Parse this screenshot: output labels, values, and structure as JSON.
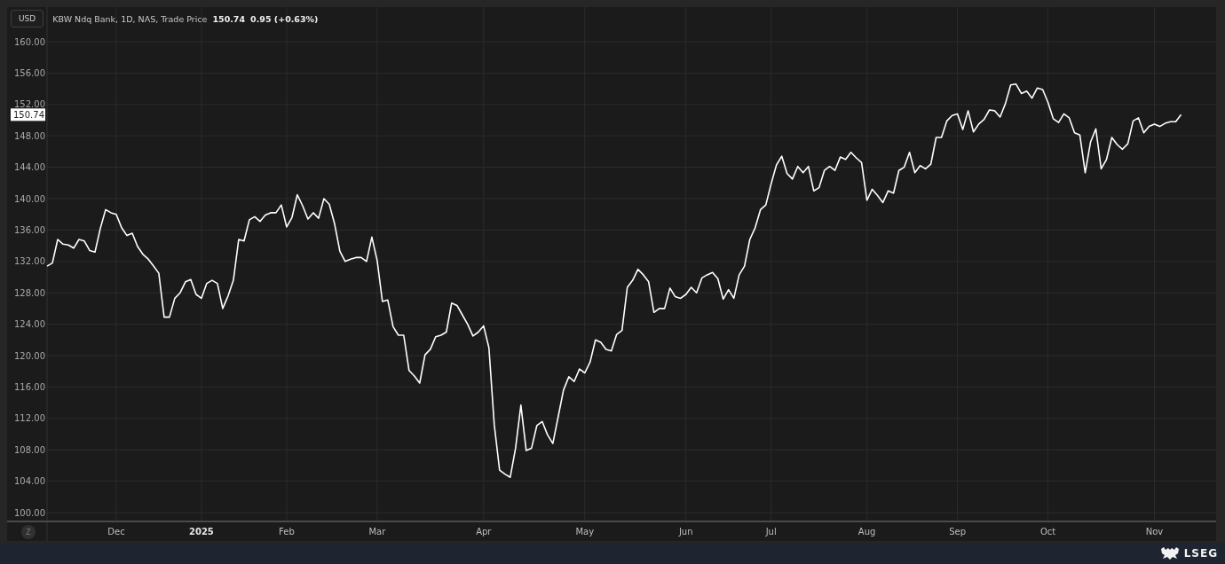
{
  "header": {
    "currency": "USD",
    "instrument": "KBW Ndq Bank, 1D, NAS, Trade Price",
    "last": "150.74",
    "change": "0.95 (+0.63%)"
  },
  "price_marker": "150.74",
  "zoom_button": "Z",
  "chart_data": {
    "type": "line",
    "ylim": [
      98.87,
      164.41
    ],
    "grid": true,
    "yticks": [
      {
        "value": 100,
        "label": "100.00"
      },
      {
        "value": 104,
        "label": "104.00"
      },
      {
        "value": 108,
        "label": "108.00"
      },
      {
        "value": 112,
        "label": "112.00"
      },
      {
        "value": 116,
        "label": "116.00"
      },
      {
        "value": 120,
        "label": "120.00"
      },
      {
        "value": 124,
        "label": "124.00"
      },
      {
        "value": 128,
        "label": "128.00"
      },
      {
        "value": 132,
        "label": "132.00"
      },
      {
        "value": 136,
        "label": "136.00"
      },
      {
        "value": 140,
        "label": "140.00"
      },
      {
        "value": 144,
        "label": "144.00"
      },
      {
        "value": 148,
        "label": "148.00"
      },
      {
        "value": 152,
        "label": "152.00"
      },
      {
        "value": 156,
        "label": "156.00"
      },
      {
        "value": 160,
        "label": "160.00"
      }
    ],
    "categories": [
      null,
      null,
      null,
      null,
      null,
      null,
      null,
      null,
      null,
      null,
      null,
      null,
      null,
      "Dec",
      null,
      null,
      null,
      null,
      null,
      null,
      null,
      null,
      null,
      null,
      null,
      null,
      null,
      null,
      null,
      "2025",
      null,
      null,
      null,
      null,
      null,
      null,
      null,
      null,
      null,
      null,
      null,
      null,
      null,
      null,
      null,
      "Feb",
      null,
      null,
      null,
      null,
      null,
      null,
      null,
      null,
      null,
      null,
      null,
      null,
      null,
      null,
      null,
      null,
      "Mar",
      null,
      null,
      null,
      null,
      null,
      null,
      null,
      null,
      null,
      null,
      null,
      null,
      null,
      null,
      null,
      null,
      null,
      null,
      null,
      "Apr",
      null,
      null,
      null,
      null,
      null,
      null,
      null,
      null,
      null,
      null,
      null,
      null,
      null,
      null,
      null,
      null,
      null,
      null,
      "May",
      null,
      null,
      null,
      null,
      null,
      null,
      null,
      null,
      null,
      null,
      null,
      null,
      null,
      null,
      null,
      null,
      null,
      null,
      "Jun",
      null,
      null,
      null,
      null,
      null,
      null,
      null,
      null,
      null,
      null,
      null,
      null,
      null,
      null,
      null,
      "Jul",
      null,
      null,
      null,
      null,
      null,
      null,
      null,
      null,
      null,
      null,
      null,
      null,
      null,
      null,
      null,
      null,
      null,
      "Aug",
      null,
      null,
      null,
      null,
      null,
      null,
      null,
      null,
      null,
      null,
      null,
      null,
      null,
      null,
      null,
      null,
      "Sep",
      null,
      null,
      null,
      null,
      null,
      null,
      null,
      null,
      null,
      null,
      null,
      null,
      null,
      null,
      null,
      null,
      "Oct",
      null,
      null,
      null,
      null,
      null,
      null,
      null,
      null,
      null,
      null,
      null,
      null,
      null,
      null,
      null,
      null,
      null,
      null,
      null,
      "Nov",
      null,
      null,
      null,
      null,
      null
    ],
    "series": [
      {
        "color": "#ffffff",
        "values": [
          131.4,
          131.8,
          134.8,
          134.2,
          134.1,
          133.7,
          134.8,
          134.6,
          133.4,
          133.2,
          136.2,
          138.6,
          138.2,
          138.0,
          136.3,
          135.3,
          135.6,
          133.9,
          132.9,
          132.3,
          131.4,
          130.5,
          124.9,
          124.9,
          127.3,
          128.0,
          129.4,
          129.7,
          127.8,
          127.3,
          129.2,
          129.6,
          129.2,
          126.0,
          127.6,
          129.6,
          134.8,
          134.6,
          137.3,
          137.7,
          137.1,
          137.9,
          138.2,
          138.2,
          139.2,
          136.4,
          137.6,
          140.5,
          139.1,
          137.4,
          138.2,
          137.5,
          140.0,
          139.3,
          136.8,
          133.3,
          132.0,
          132.3,
          132.5,
          132.5,
          132.0,
          135.1,
          132.1,
          126.9,
          127.1,
          123.7,
          122.6,
          122.6,
          118.1,
          117.4,
          116.5,
          120.1,
          120.8,
          122.4,
          122.6,
          123.0,
          126.7,
          126.4,
          125.2,
          124.0,
          122.5,
          123.0,
          123.8,
          121.0,
          111.2,
          105.4,
          104.9,
          104.5,
          108.2,
          113.7,
          107.9,
          108.2,
          111.1,
          111.6,
          109.9,
          108.8,
          112.2,
          115.6,
          117.3,
          116.7,
          118.3,
          117.8,
          119.2,
          122.0,
          121.7,
          120.8,
          120.6,
          122.7,
          123.2,
          128.7,
          129.6,
          131.0,
          130.3,
          129.4,
          125.5,
          126.0,
          126.0,
          128.6,
          127.5,
          127.3,
          127.8,
          128.7,
          128.0,
          129.9,
          130.3,
          130.6,
          129.8,
          127.2,
          128.4,
          127.3,
          130.3,
          131.4,
          134.8,
          136.3,
          138.6,
          139.2,
          141.9,
          144.3,
          145.4,
          143.2,
          142.5,
          144.1,
          143.3,
          144.1,
          141.0,
          141.4,
          143.6,
          144.1,
          143.6,
          145.3,
          145.0,
          145.9,
          145.2,
          144.6,
          139.8,
          141.2,
          140.4,
          139.5,
          141.0,
          140.7,
          143.6,
          144.0,
          145.9,
          143.3,
          144.2,
          143.8,
          144.4,
          147.8,
          147.8,
          149.9,
          150.6,
          150.8,
          148.8,
          151.2,
          148.5,
          149.5,
          150.1,
          151.3,
          151.2,
          150.4,
          152.1,
          154.5,
          154.6,
          153.4,
          153.7,
          152.8,
          154.1,
          153.9,
          152.3,
          150.2,
          149.7,
          150.8,
          150.3,
          148.4,
          148.1,
          143.3,
          147.2,
          148.9,
          143.8,
          145.0,
          147.8,
          146.9,
          146.3,
          147.0,
          149.9,
          150.3,
          148.4,
          149.2,
          149.5,
          149.2,
          149.6,
          149.8,
          149.8,
          150.7
        ]
      }
    ]
  },
  "brand": "LSEG"
}
